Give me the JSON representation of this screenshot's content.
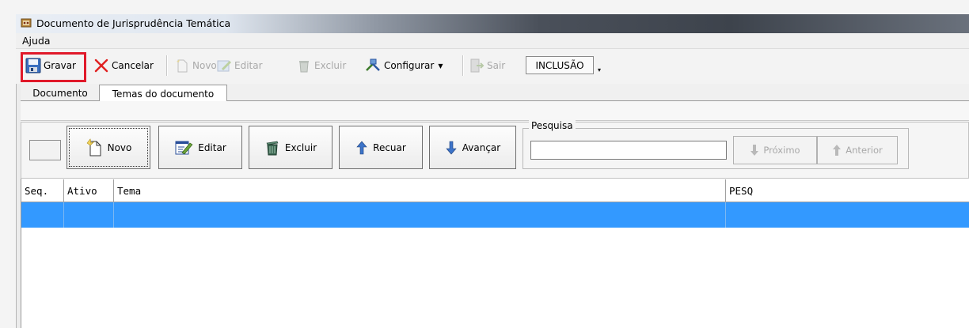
{
  "window": {
    "title": "Documento de Jurisprudência Temática"
  },
  "menu": {
    "items": [
      "Ajuda"
    ]
  },
  "toolbar": {
    "gravar": "Gravar",
    "cancelar": "Cancelar",
    "novo": "Novo",
    "editar": "Editar",
    "excluir": "Excluir",
    "configurar": "Configurar",
    "sair": "Sair",
    "mode": "INCLUSÃO"
  },
  "tabs": {
    "documento": "Documento",
    "temas": "Temas do documento",
    "active": "Temas do documento"
  },
  "panel": {
    "novo": "Novo",
    "editar": "Editar",
    "excluir": "Excluir",
    "recuar": "Recuar",
    "avancar": "Avançar"
  },
  "search": {
    "label": "Pesquisa",
    "value": "",
    "proximo": "Próximo",
    "anterior": "Anterior"
  },
  "grid": {
    "columns": [
      "Seq.",
      "Ativo",
      "Tema",
      "PESQ"
    ],
    "rows": [
      {
        "seq": "",
        "ativo": "",
        "tema": "",
        "pesq": ""
      }
    ]
  },
  "colors": {
    "selection": "#3399ff",
    "highlight": "#e0192a"
  }
}
